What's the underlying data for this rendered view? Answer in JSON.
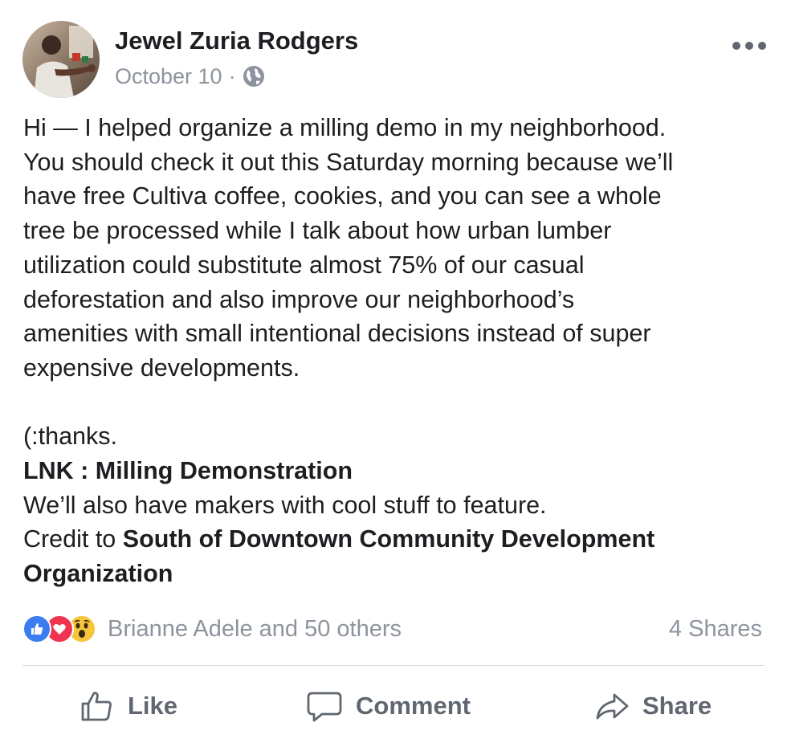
{
  "post": {
    "author": "Jewel Zuria Rodgers",
    "date": "October 10",
    "separator": "·",
    "privacy_icon": "globe-icon",
    "more_icon": "more-options-icon",
    "body": {
      "paragraph_lines": [
        "Hi — I helped organize a milling demo in my neighborhood.",
        "You should check it out this Saturday morning because we’ll",
        "have free Cultiva coffee, cookies, and you can see a whole",
        "tree be processed while I talk about how urban lumber",
        "utilization could substitute almost 75% of our casual",
        "deforestation and also improve our neighborhood’s",
        "amenities with small intentional decisions instead of super",
        "expensive developments."
      ],
      "signoff": "(:thanks.",
      "event_title": "LNK : Milling Demonstration",
      "makers_line": "We’ll also have makers with cool stuff to feature.",
      "credit_prefix": "Credit to ",
      "credit_org_line1": "South of Downtown Community Development",
      "credit_org_line2": "Organization"
    },
    "reactions": {
      "icons": [
        "like-reaction-icon",
        "love-reaction-icon",
        "wow-reaction-icon"
      ],
      "summary": "Brianne Adele and 50 others",
      "shares": "4 Shares"
    },
    "actions": {
      "like": "Like",
      "comment": "Comment",
      "share": "Share"
    },
    "colors": {
      "text": "#1c1e21",
      "secondary": "#8d949e",
      "action": "#606770",
      "like_blue": "#3b7cf0",
      "love_red": "#f0344f",
      "wow_yellow": "#f7c53b"
    }
  }
}
